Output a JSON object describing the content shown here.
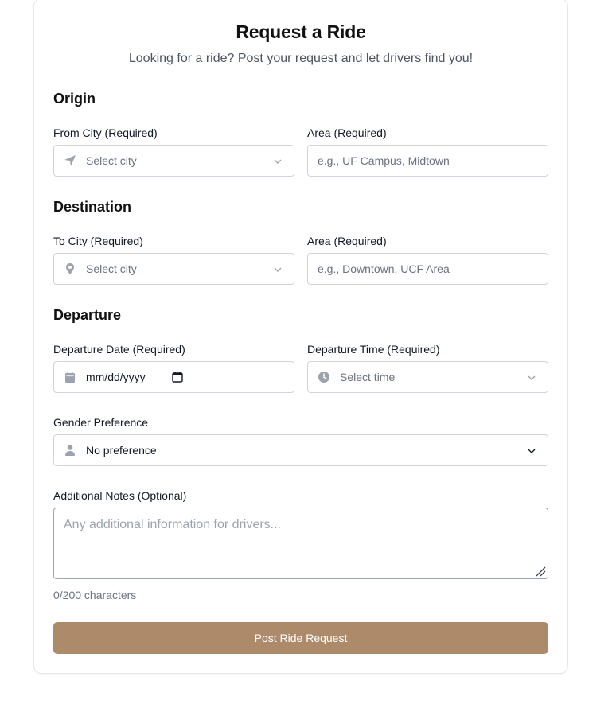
{
  "header": {
    "title": "Request a Ride",
    "subtitle": "Looking for a ride? Post your request and let drivers find you!"
  },
  "origin": {
    "heading": "Origin",
    "city_label": "From City (Required)",
    "city_value": "Select city",
    "city_icon": "navigation-arrow-icon",
    "area_label": "Area (Required)",
    "area_placeholder": "e.g., UF Campus, Midtown"
  },
  "destination": {
    "heading": "Destination",
    "city_label": "To City (Required)",
    "city_value": "Select city",
    "city_icon": "map-pin-icon",
    "area_label": "Area (Required)",
    "area_placeholder": "e.g., Downtown, UCF Area"
  },
  "departure": {
    "heading": "Departure",
    "date_label": "Departure Date (Required)",
    "date_value": "mm/dd/yyyy",
    "time_label": "Departure Time (Required)",
    "time_value": "Select time"
  },
  "gender": {
    "label": "Gender Preference",
    "value": "No preference"
  },
  "notes": {
    "label": "Additional Notes (Optional)",
    "placeholder": "Any additional information for drivers...",
    "counter": "0/200 characters"
  },
  "submit": {
    "label": "Post Ride Request"
  },
  "colors": {
    "accent": "#ad8b6a",
    "icon": "#9ca3af",
    "border": "#d1d5db"
  }
}
